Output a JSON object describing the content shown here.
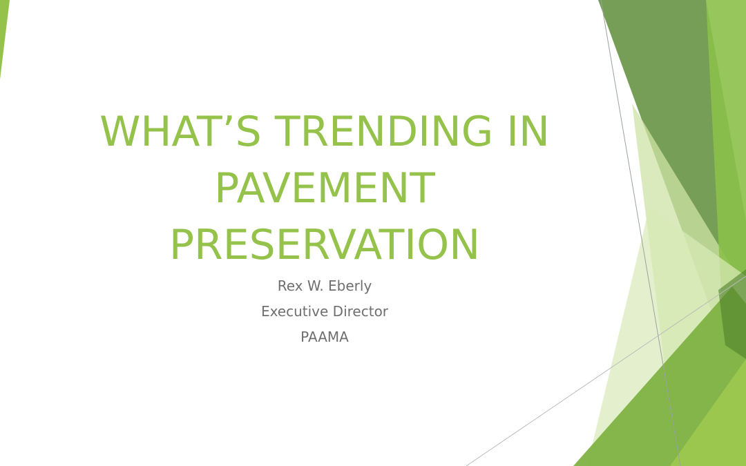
{
  "slide": {
    "title_lines": [
      "WHAT’S TRENDING IN",
      "PAVEMENT",
      "PRESERVATION"
    ],
    "subtitle_lines": [
      "Rex W. Eberly",
      "Executive Director",
      "PAAMA"
    ]
  },
  "colors": {
    "title": "#94c24a",
    "subtitle": "#6f6f6f",
    "accent_dark": "#5e8d3a",
    "accent_mid": "#7fb243",
    "accent_light": "#cfe3a6",
    "background": "#ffffff"
  }
}
